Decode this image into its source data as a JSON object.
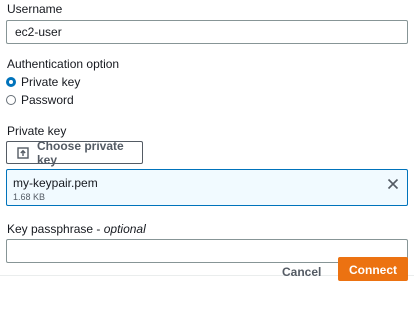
{
  "username": {
    "label": "Username",
    "value": "ec2-user"
  },
  "auth": {
    "label": "Authentication option",
    "options": [
      {
        "label": "Private key",
        "selected": true
      },
      {
        "label": "Password",
        "selected": false
      }
    ]
  },
  "private_key": {
    "label": "Private key",
    "choose_button": "Choose private key",
    "file_name": "my-keypair.pem",
    "file_size": "1.68 KB"
  },
  "passphrase": {
    "label": "Key passphrase",
    "optional": "optional",
    "separator": " - ",
    "value": ""
  },
  "footer": {
    "cancel": "Cancel",
    "connect": "Connect"
  },
  "colors": {
    "accent": "#0073bb",
    "primary_button": "#ec7211"
  }
}
